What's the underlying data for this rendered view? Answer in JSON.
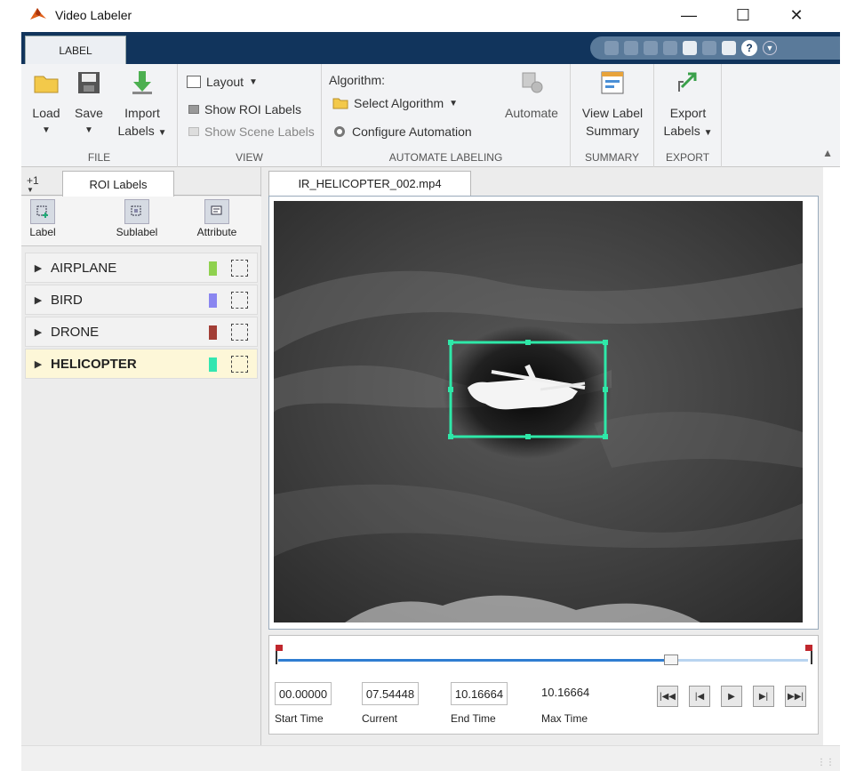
{
  "window": {
    "title": "Video Labeler",
    "icons": {
      "app": "matlab-logo-icon",
      "minimize": "minimize-icon",
      "maximize": "maximize-icon",
      "close": "close-icon"
    }
  },
  "ribbon": {
    "tab": "LABEL",
    "file": {
      "group_label": "FILE",
      "load": "Load",
      "save": "Save",
      "import_line1": "Import",
      "import_line2": "Labels"
    },
    "view": {
      "group_label": "VIEW",
      "layout": "Layout",
      "show_roi": "Show ROI Labels",
      "show_scene": "Show Scene Labels"
    },
    "automate": {
      "group_label": "AUTOMATE LABELING",
      "algorithm_heading": "Algorithm:",
      "select_algorithm": "Select Algorithm",
      "configure": "Configure Automation",
      "automate": "Automate"
    },
    "summary": {
      "group_label": "SUMMARY",
      "line1": "View Label",
      "line2": "Summary"
    },
    "export": {
      "group_label": "EXPORT",
      "line1": "Export",
      "line2": "Labels"
    }
  },
  "left_panel": {
    "plus_label": "+1",
    "tab": "ROI Labels",
    "tools": {
      "label": "Label",
      "sublabel": "Sublabel",
      "attribute": "Attribute"
    },
    "labels": [
      {
        "name": "AIRPLANE",
        "color": "#8fd14f",
        "selected": false
      },
      {
        "name": "BIRD",
        "color": "#8a86f0",
        "selected": false
      },
      {
        "name": "DRONE",
        "color": "#a23e36",
        "selected": false
      },
      {
        "name": "HELICOPTER",
        "color": "#33e6b0",
        "selected": true
      }
    ]
  },
  "video": {
    "tab": "IR_HELICOPTER_002.mp4",
    "bbox_color": "#2ee8a8"
  },
  "playback": {
    "start_time": "00.00000",
    "current": "07.54448",
    "end_time": "10.16664",
    "max_time": "10.16664",
    "start_caption": "Start Time",
    "current_caption": "Current",
    "end_caption": "End Time",
    "max_caption": "Max Time",
    "progress_fraction": 0.742,
    "buttons": [
      "first-frame-icon",
      "previous-frame-icon",
      "play-icon",
      "next-frame-icon",
      "last-frame-icon"
    ]
  }
}
